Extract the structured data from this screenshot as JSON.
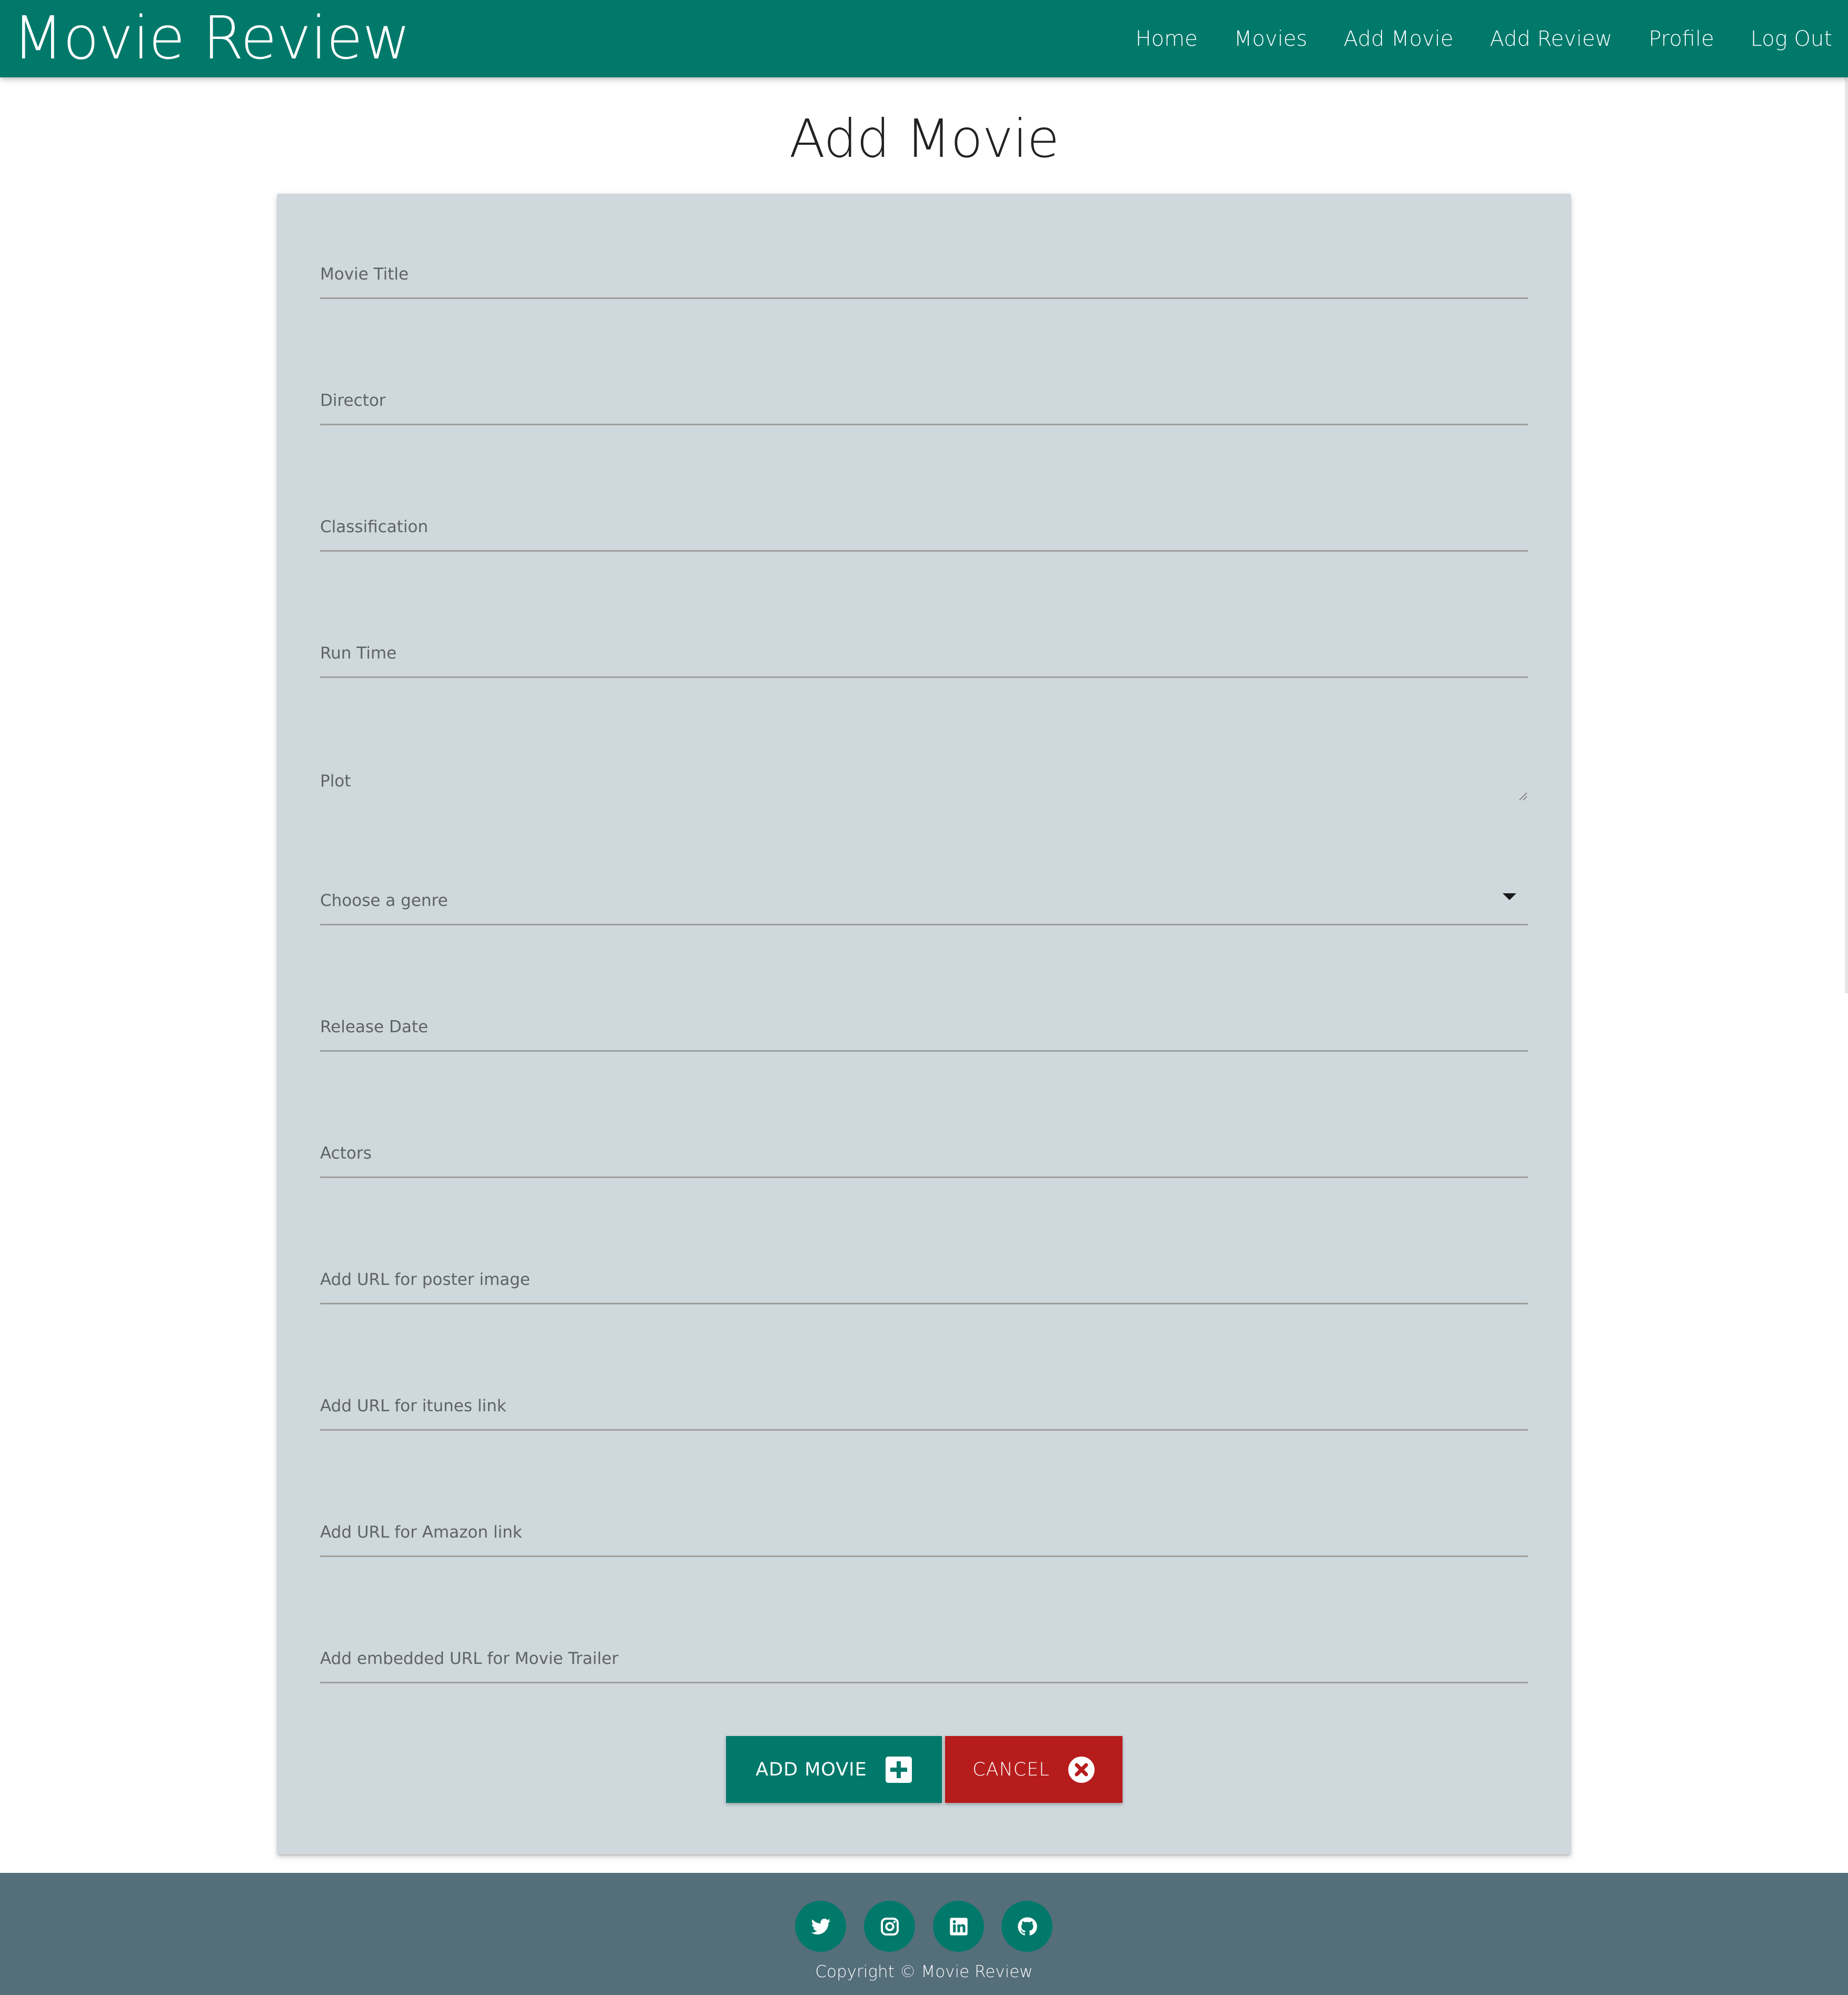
{
  "brand": {
    "title": "Movie Review"
  },
  "nav": {
    "items": [
      {
        "label": "Home"
      },
      {
        "label": "Movies"
      },
      {
        "label": "Add Movie"
      },
      {
        "label": "Add Review"
      },
      {
        "label": "Profile"
      },
      {
        "label": "Log Out"
      }
    ]
  },
  "page": {
    "title": "Add Movie"
  },
  "form": {
    "fields": [
      {
        "label": "Movie Title",
        "value": ""
      },
      {
        "label": "Director",
        "value": ""
      },
      {
        "label": "Classification",
        "value": ""
      },
      {
        "label": "Run Time",
        "value": ""
      },
      {
        "label": "Plot",
        "value": ""
      },
      {
        "label": "Choose a genre",
        "value": ""
      },
      {
        "label": "Release Date",
        "value": ""
      },
      {
        "label": "Actors",
        "value": ""
      },
      {
        "label": "Add URL for poster image",
        "value": ""
      },
      {
        "label": "Add URL for itunes link",
        "value": ""
      },
      {
        "label": "Add URL for Amazon link",
        "value": ""
      },
      {
        "label": "Add embedded URL for Movie Trailer",
        "value": ""
      }
    ],
    "submit_label": "ADD MOVIE",
    "submit_icon": "plus-square-icon",
    "cancel_label": "CANCEL",
    "cancel_icon": "times-circle-icon"
  },
  "footer": {
    "social": [
      {
        "name": "twitter-icon"
      },
      {
        "name": "instagram-icon"
      },
      {
        "name": "linkedin-icon"
      },
      {
        "name": "github-icon"
      }
    ],
    "copyright": "Copyright © Movie Review"
  },
  "colors": {
    "primary": "#00796b",
    "danger": "#b71c1c",
    "card": "#cfd8dc",
    "footer": "#546e7a"
  }
}
